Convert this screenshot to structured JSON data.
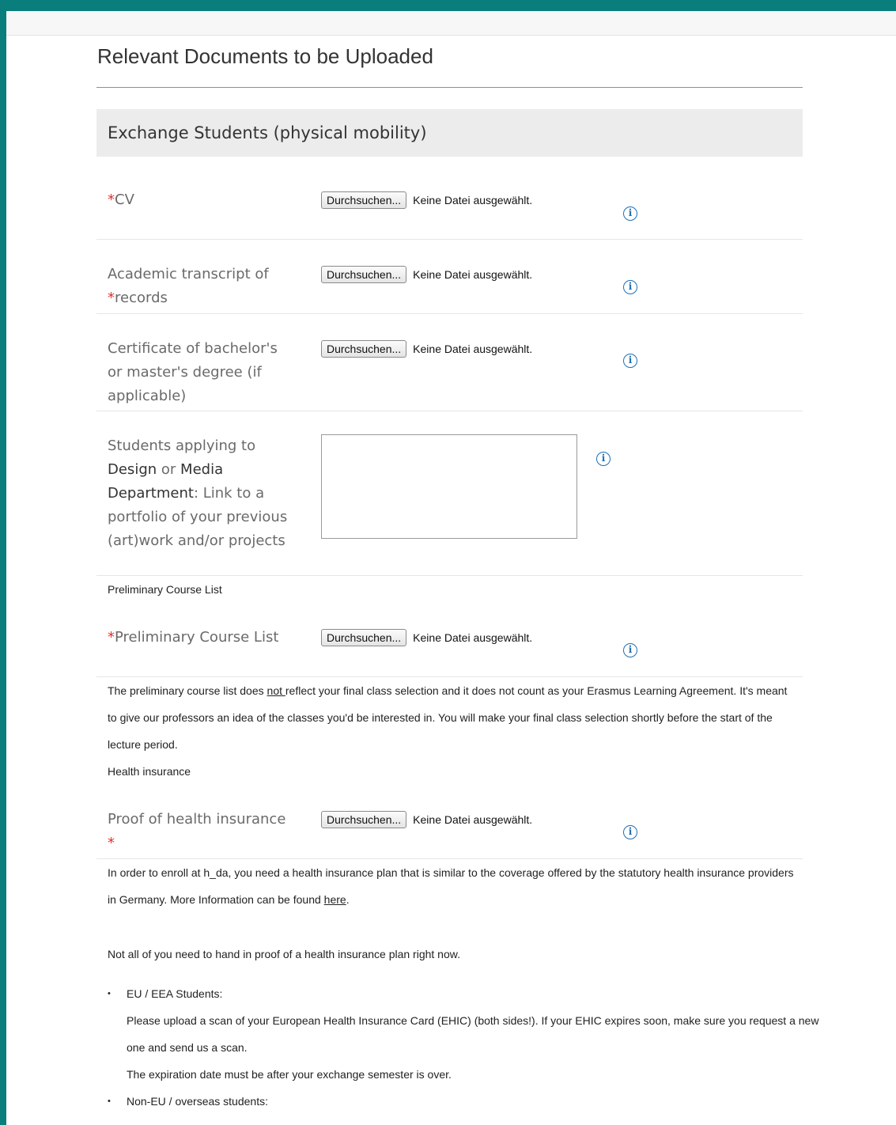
{
  "page": {
    "title": "Relevant Documents to be Uploaded",
    "section_heading": "Exchange Students (physical mobility)"
  },
  "file_widget": {
    "browse_label": "Durchsuchen...",
    "no_file_text": "Keine Datei ausgewählt."
  },
  "fields": {
    "cv": {
      "required_mark": "*",
      "label": "CV"
    },
    "transcript": {
      "label_line1": "Academic transcript of",
      "required_mark": "*",
      "label_line2": "records"
    },
    "certificate": {
      "label": "Certificate of bachelor's or master's degree (if applicable)"
    },
    "portfolio": {
      "label_pre": "Students applying to",
      "label_design": "Design",
      "label_or": "or",
      "label_media": "Media",
      "label_dept": "Department",
      "label_post": ": Link to a portfolio of your previous (art)work and/or projects",
      "value": ""
    },
    "course_list": {
      "required_mark": "*",
      "label": "Preliminary Course List"
    },
    "health": {
      "label": "Proof of health insurance",
      "required_mark": "*"
    }
  },
  "info_icon_glyph": "i",
  "sections": {
    "course_list_heading": "Preliminary Course List",
    "health_heading": "Health insurance"
  },
  "notes": {
    "course_list_pre": "The preliminary course list does ",
    "course_list_not": "not ",
    "course_list_post": "reflect your final class selection and it does not count as your Erasmus Learning Agreement. It's meant to give our professors an idea of the classes you'd be interested in. You will make your final class selection shortly before the start of the lecture period.",
    "health_pre": "In order to enroll at h_da, you need a health insurance plan that is similar to the coverage offered by the statutory health insurance providers in Germany. More Information can be found ",
    "health_link": "here",
    "health_post": ".",
    "not_all": "Not all of you need to hand in proof of a health insurance plan right now."
  },
  "bullets": {
    "eu_title": "EU / EEA Students:",
    "eu_text": "Please upload a scan of your European Health Insurance Card (EHIC) (both sides!). If your EHIC expires soon, make sure you request a new one and send us a scan.",
    "eu_text2": "The expiration date must be after your exchange semester is over.",
    "noneu_title": "Non-EU / overseas students:"
  }
}
